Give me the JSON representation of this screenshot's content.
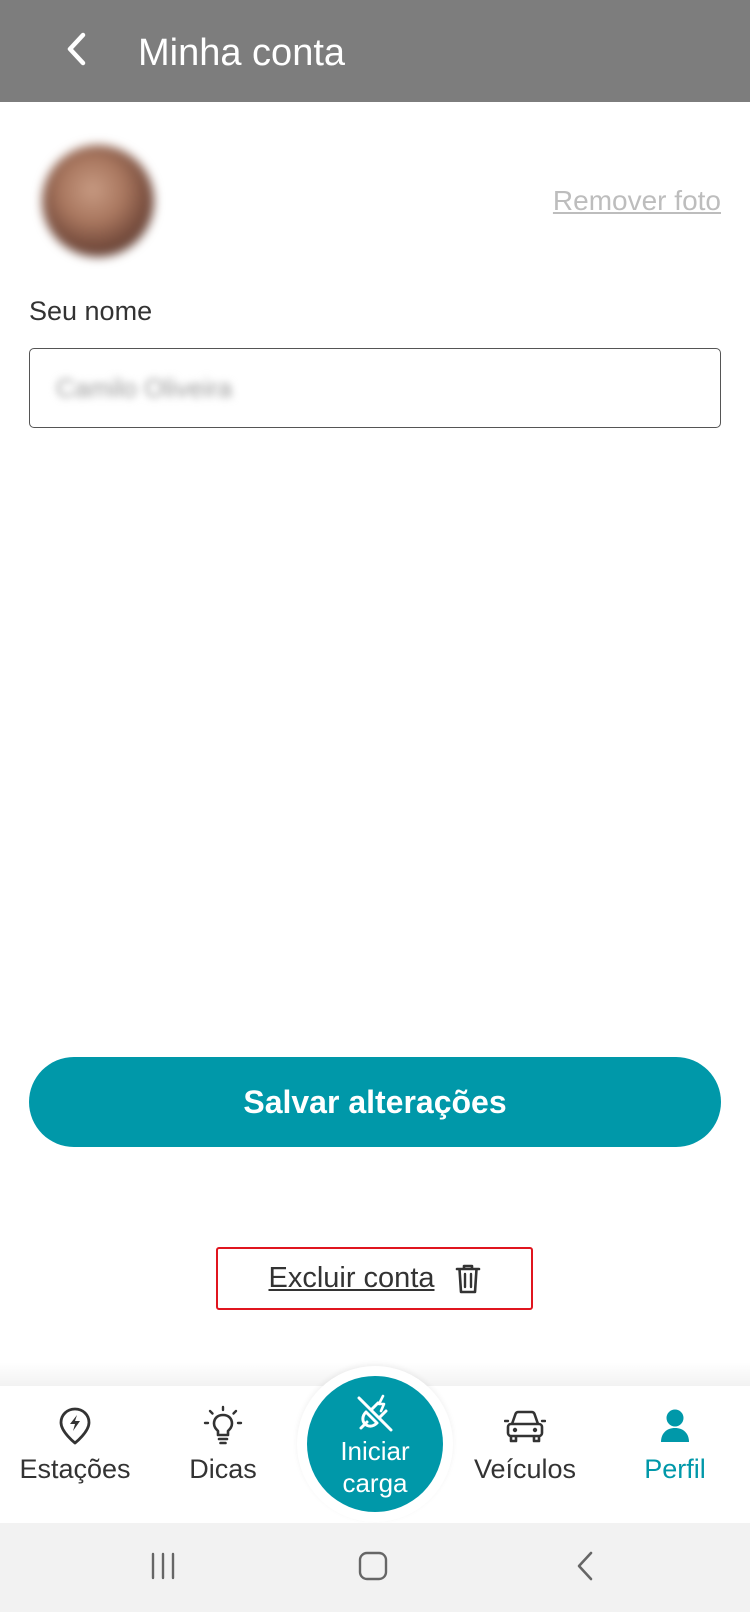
{
  "header": {
    "title": "Minha conta",
    "back_icon": "chevron-left-icon"
  },
  "profile": {
    "remove_photo_label": "Remover foto"
  },
  "form": {
    "name_label": "Seu nome",
    "name_value": "Camilo Oliveira"
  },
  "actions": {
    "save_label": "Salvar alterações",
    "delete_label": "Excluir conta",
    "delete_icon": "trash-icon"
  },
  "nav": {
    "items": [
      {
        "label": "Estações",
        "icon": "charging-station-pin-icon",
        "active": false
      },
      {
        "label": "Dicas",
        "icon": "lightbulb-icon",
        "active": false
      },
      {
        "label": "Veículos",
        "icon": "car-icon",
        "active": false
      },
      {
        "label": "Perfil",
        "icon": "person-icon",
        "active": true
      }
    ],
    "fab": {
      "line1": "Iniciar",
      "line2": "carga",
      "icon": "plug-icon"
    }
  },
  "colors": {
    "accent": "#0098a9",
    "header": "#7d7d7d",
    "danger_outline": "#e0151f"
  }
}
